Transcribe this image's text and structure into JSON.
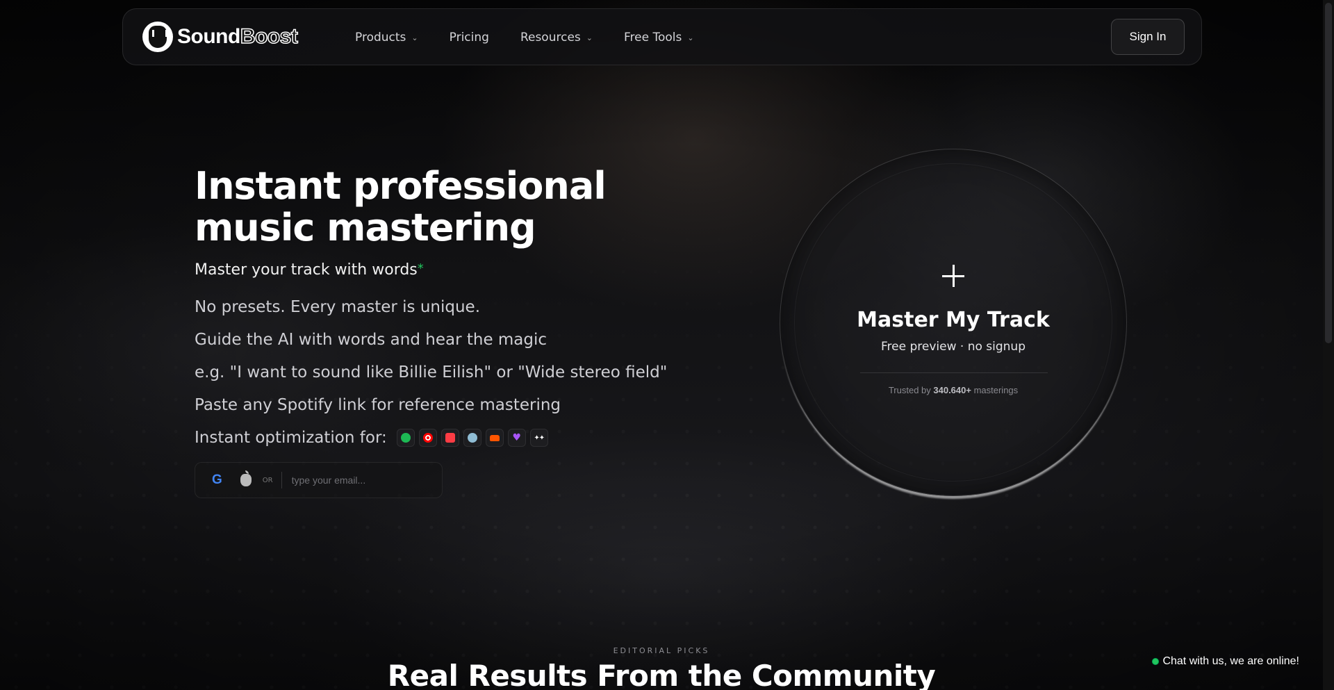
{
  "brand": {
    "name_part1": "Sound",
    "name_part2": "Boost"
  },
  "nav": {
    "items": [
      {
        "label": "Products",
        "has_dropdown": true
      },
      {
        "label": "Pricing",
        "has_dropdown": false
      },
      {
        "label": "Resources",
        "has_dropdown": true
      },
      {
        "label": "Free Tools",
        "has_dropdown": true
      }
    ],
    "signin_label": "Sign In"
  },
  "hero": {
    "title_line1": "Instant professional",
    "title_line2": "music mastering",
    "subhead": "Master your track with words",
    "subhead_mark": "*",
    "bullets": [
      "No presets. Every master is unique.",
      "Guide the AI with words and hear the magic",
      "e.g. \"I want to sound like Billie Eilish\" or \"Wide stereo field\"",
      "Paste any Spotify link for reference mastering"
    ],
    "optimization_label": "Instant optimization for:",
    "platform_icons": [
      "spotify-icon",
      "youtube-music-icon",
      "apple-music-icon",
      "deezer-icon",
      "soundcloud-icon",
      "heart-icon",
      "tidal-icon"
    ],
    "signup": {
      "google_glyph": "G",
      "or_label": "OR",
      "email_placeholder": "type your email..."
    }
  },
  "upload": {
    "title": "Master My Track",
    "subtitle": "Free preview · no signup",
    "trusted_prefix": "Trusted by ",
    "trusted_count": "340.640+",
    "trusted_suffix": " masterings"
  },
  "community": {
    "eyebrow": "EDITORIAL PICKS",
    "title": "Real Results From the Community"
  },
  "chat": {
    "label": "Chat with us, we are online!"
  },
  "colors": {
    "accent_green": "#22c55e",
    "background": "#0b0b0c"
  }
}
